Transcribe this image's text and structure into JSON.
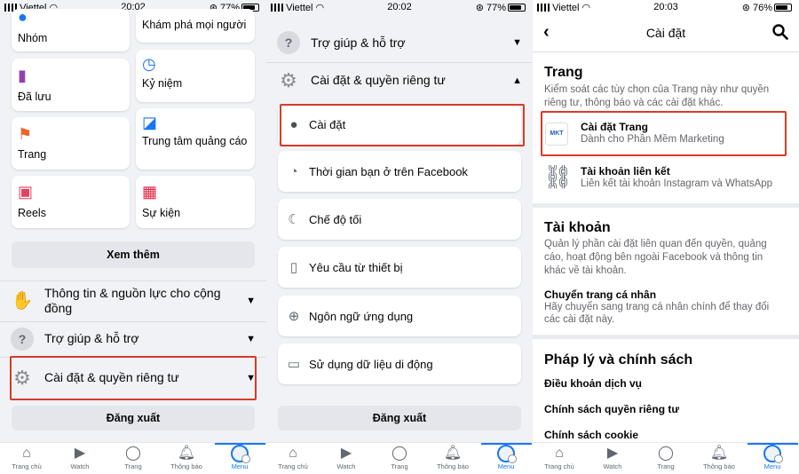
{
  "status_bars": [
    {
      "carrier": "Viettel",
      "time": "20:02",
      "battery": "77%"
    },
    {
      "carrier": "Viettel",
      "time": "20:02",
      "battery": "77%"
    },
    {
      "carrier": "Viettel",
      "time": "20:03",
      "battery": "76%"
    }
  ],
  "panel1": {
    "shortcuts": [
      {
        "label": "Nhóm",
        "icon": "groups-icon"
      },
      {
        "label": "Khám phá mọi người",
        "icon": "find-friends-icon"
      },
      {
        "label": "Đã lưu",
        "icon": "saved-icon"
      },
      {
        "label": "Kỷ niệm",
        "icon": "memories-icon"
      },
      {
        "label": "Trang",
        "icon": "pages-flag-icon"
      },
      {
        "label": "Trung tâm quảng cáo",
        "icon": "ads-center-icon"
      },
      {
        "label": "Reels",
        "icon": "reels-icon"
      },
      {
        "label": "Sự kiện",
        "icon": "events-icon"
      }
    ],
    "see_more": "Xem thêm",
    "community": "Thông tin & nguồn lực cho cộng đồng",
    "help": "Trợ giúp & hỗ trợ",
    "settings_privacy": "Cài đặt & quyền riêng tư",
    "logout": "Đăng xuất"
  },
  "panel2": {
    "help": "Trợ giúp & hỗ trợ",
    "settings_privacy": "Cài đặt & quyền riêng tư",
    "subitems": [
      {
        "label": "Cài đặt",
        "icon": "profile-settings-icon"
      },
      {
        "label": "Thời gian bạn ở trên Facebook",
        "icon": "clock-icon"
      },
      {
        "label": "Chế độ tối",
        "icon": "moon-icon"
      },
      {
        "label": "Yêu cầu từ thiết bị",
        "icon": "device-request-icon"
      },
      {
        "label": "Ngôn ngữ ứng dụng",
        "icon": "globe-icon"
      },
      {
        "label": "Sử dụng dữ liệu di động",
        "icon": "mobile-data-icon"
      }
    ],
    "logout": "Đăng xuất"
  },
  "panel3": {
    "title": "Cài đặt",
    "page_section": {
      "title": "Trang",
      "description": "Kiểm soát các tùy chọn của Trang này như quyền riêng tư, thông báo và các cài đặt khác.",
      "page_settings_title": "Cài đặt Trang",
      "page_settings_subtitle": "Dành cho Phần Mềm Marketing",
      "linked_title": "Tài khoản liên kết",
      "linked_subtitle": "Liên kết tài khoản Instagram và WhatsApp",
      "logo_text": "MKT"
    },
    "account_section": {
      "title": "Tài khoản",
      "description": "Quản lý phần cài đặt liên quan đến quyền, quảng cáo, hoạt động bên ngoài Facebook và thông tin khác về tài khoản.",
      "switch_title": "Chuyển trang cá nhân",
      "switch_desc": "Hãy chuyển sang trang cá nhân chính để thay đổi các cài đặt này."
    },
    "legal_section": {
      "title": "Pháp lý và chính sách",
      "items": [
        "Điều khoản dịch vụ",
        "Chính sách quyền riêng tư",
        "Chính sách cookie"
      ]
    }
  },
  "tabs": [
    {
      "label": "Trang chủ",
      "icon": "home-icon"
    },
    {
      "label": "Watch",
      "icon": "watch-icon"
    },
    {
      "label": "Trang",
      "icon": "page-icon"
    },
    {
      "label": "Thông báo",
      "icon": "bell-icon"
    },
    {
      "label": "Menu",
      "icon": "menu-avatar-icon"
    }
  ],
  "colors": {
    "accent": "#1877f2",
    "highlight": "#d83a2b",
    "background": "#f0f2f5"
  }
}
